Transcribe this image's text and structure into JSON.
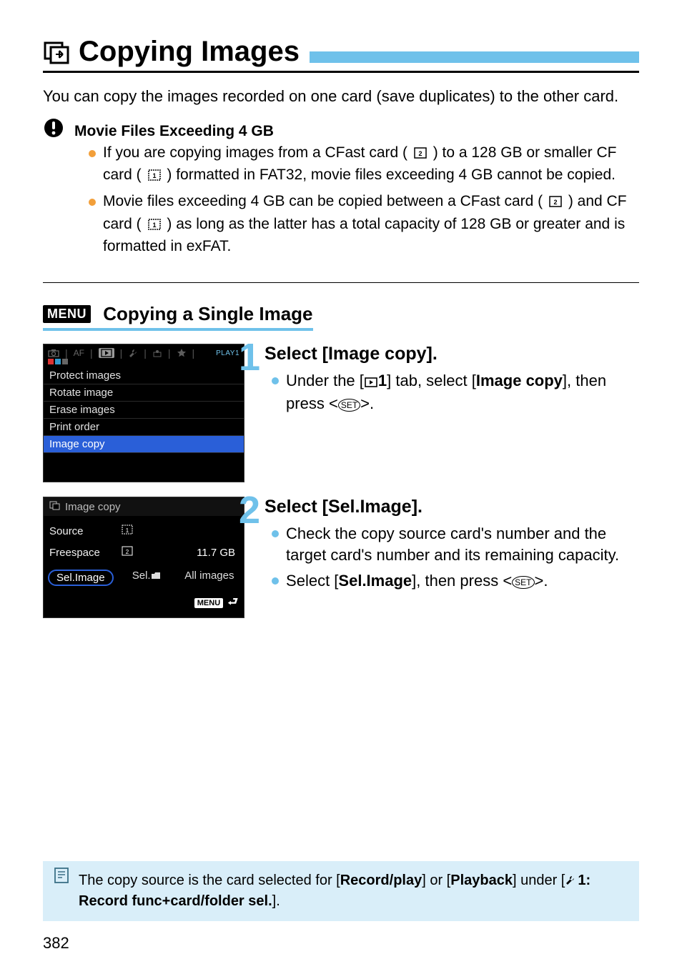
{
  "title": "Copying Images",
  "intro": "You can copy the images recorded on one card (save duplicates) to the other card.",
  "warn": {
    "heading": "Movie Files Exceeding 4 GB",
    "items": [
      {
        "pre": "If you are copying images from a CFast card (",
        "mid": ") to a 128 GB or smaller CF card (",
        "post": ") formatted in FAT32, movie files exceeding 4 GB cannot be copied."
      },
      {
        "pre": "Movie files exceeding 4 GB can be copied between a CFast card (",
        "mid": ") and CF card (",
        "post": ") as long as the latter has a total capacity of 128 GB or greater and is formatted in exFAT."
      }
    ]
  },
  "subheading": {
    "menu_badge": "MENU",
    "text": "Copying a Single Image"
  },
  "shot1": {
    "tab_label": "PLAY1",
    "af": "AF",
    "rows": [
      "Protect images",
      "Rotate image",
      "Erase images",
      "Print order",
      "Image copy"
    ]
  },
  "shot2": {
    "title": "Image copy",
    "source_label": "Source",
    "freespace_label": "Freespace",
    "freespace_value": "11.7 GB",
    "buttons": [
      "Sel.Image",
      "Sel.",
      "All images"
    ],
    "menu_chip": "MENU"
  },
  "step1": {
    "title": "Select [Image copy].",
    "line_pre": "Under the [",
    "line_tab": "1",
    "line_mid": "] tab, select [",
    "line_bold": "Image copy",
    "line_post": "], then press <",
    "set": "SET",
    "line_end": ">."
  },
  "step2": {
    "title": "Select [Sel.Image].",
    "bullets": [
      "Check the copy source card's number and the target card's number and its remaining capacity."
    ],
    "sel_pre": "Select [",
    "sel_bold": "Sel.Image",
    "sel_mid": "], then press <",
    "set": "SET",
    "sel_end": ">."
  },
  "note": {
    "pre": "The copy source is the card selected for [",
    "b1": "Record/play",
    "mid1": "] or [",
    "b2": "Playback",
    "mid2": "] under [",
    "wrench_num": "1",
    "b3": ": Record func+card/folder sel.",
    "post": "]."
  },
  "page_number": "382"
}
